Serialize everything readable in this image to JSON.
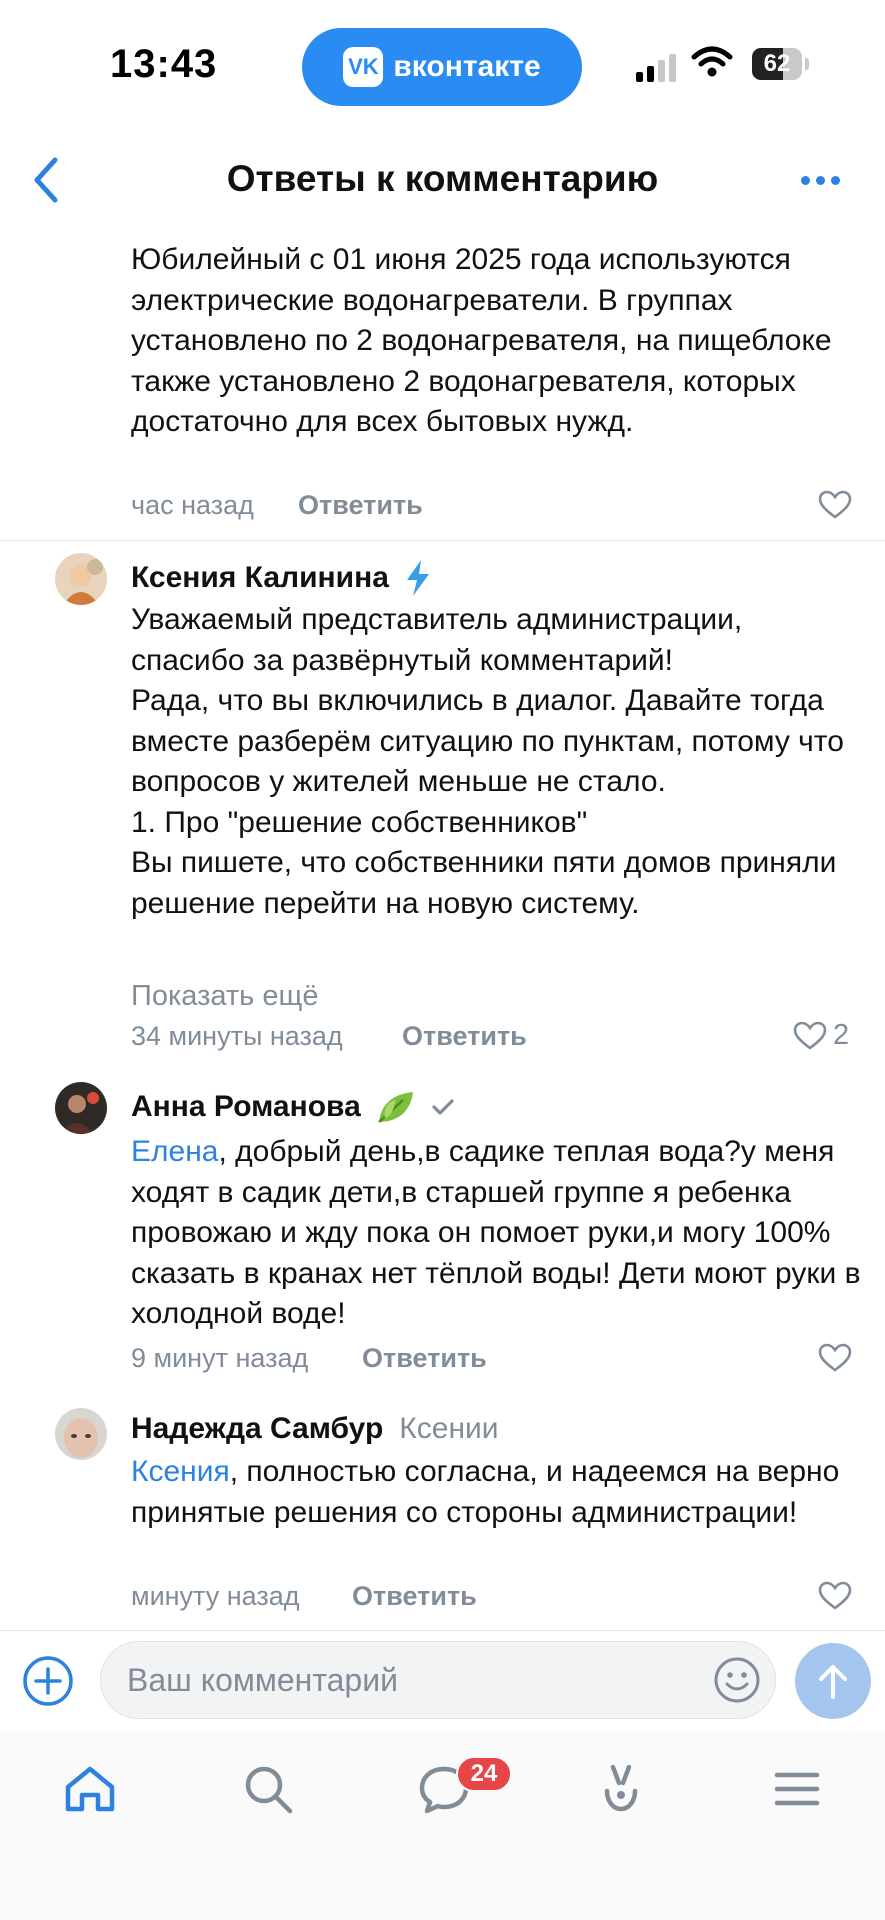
{
  "status_bar": {
    "time": "13:43",
    "app_label": "вконтакте",
    "vk_logo": "VK",
    "battery": "62",
    "battery_level": 0.62
  },
  "header": {
    "title": "Ответы к комментарию"
  },
  "comments": [
    {
      "text": "Юбилейный с 01 июня 2025 года используются электрические водонагреватели. В группах установлено по 2 водонагревателя, на пищеблоке также установлено 2 водонагревателя, которых достаточно для всех бытовых нужд.",
      "time": "час назад",
      "reply": "Ответить",
      "likes": ""
    },
    {
      "author": "Ксения Калинина",
      "text": "Уважаемый представитель администрации, спасибо за развёрнутый комментарий!\nРада, что вы включились в диалог. Давайте тогда вместе разберём ситуацию по пунктам, потому что вопросов у жителей меньше не стало.\n1. Про \"решение собственников\"\nВы пишете, что собственники пяти домов приняли решение перейти на новую систему.",
      "show_more": "Показать ещё",
      "time": "34 минуты назад",
      "reply": "Ответить",
      "likes": "2"
    },
    {
      "author": "Анна Романова",
      "mention": "Елена",
      "text": ", добрый день,в садике теплая вода?у меня ходят в садик дети,в старшей группе я ребенка провожаю и жду пока он помоет руки,и могу 100% сказать в кранах нет тёплой воды! Дети моют руки в холодной воде!",
      "time": "9 минут назад",
      "reply": "Ответить",
      "likes": ""
    },
    {
      "author": "Надежда Самбур",
      "addressee": "Ксении",
      "mention": "Ксения",
      "text": ", полностью  согласна, и надеемся на верно принятые решения со стороны администрации!",
      "time": "минуту назад",
      "reply": "Ответить",
      "likes": ""
    }
  ],
  "composer": {
    "placeholder": "Ваш комментарий"
  },
  "tabbar": {
    "messages_badge": "24"
  },
  "colors": {
    "accent": "#2d81e0",
    "muted": "#818c99",
    "badge": "#e64646",
    "vk_blue": "#2a8bf2"
  },
  "icons": [
    "back-chevron-icon",
    "more-dots-icon",
    "heart-icon",
    "lightning-emoji",
    "leaf-emoji",
    "verified-check-icon",
    "plus-circle-icon",
    "emoji-icon",
    "send-arrow-icon",
    "home-icon",
    "search-icon",
    "messages-icon",
    "clips-icon",
    "menu-icon"
  ]
}
